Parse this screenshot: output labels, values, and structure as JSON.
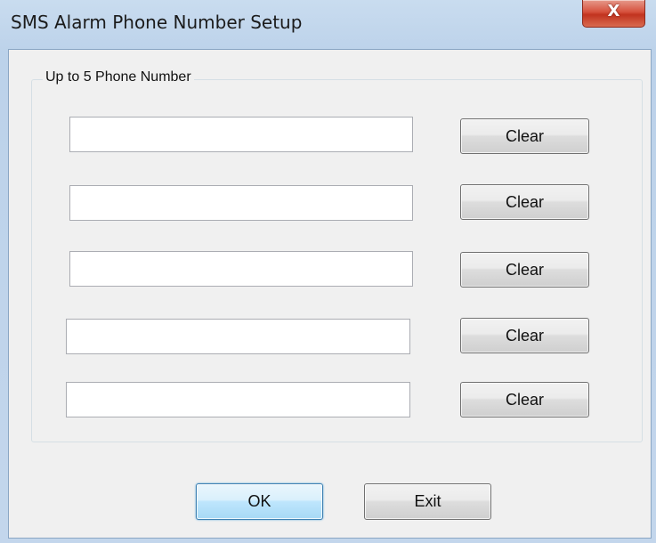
{
  "window": {
    "title": "SMS Alarm Phone Number Setup",
    "close_label": "X"
  },
  "group": {
    "legend": "Up to 5 Phone Number"
  },
  "phones": [
    {
      "value": "",
      "clear_label": "Clear"
    },
    {
      "value": "",
      "clear_label": "Clear"
    },
    {
      "value": "",
      "clear_label": "Clear"
    },
    {
      "value": "",
      "clear_label": "Clear"
    },
    {
      "value": "",
      "clear_label": "Clear"
    }
  ],
  "buttons": {
    "ok_label": "OK",
    "exit_label": "Exit"
  }
}
